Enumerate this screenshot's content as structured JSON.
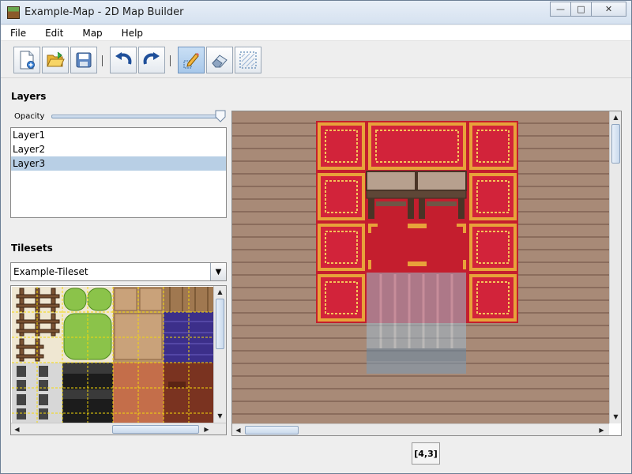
{
  "window": {
    "title": "Example-Map - 2D Map Builder"
  },
  "menu": [
    "File",
    "Edit",
    "Map",
    "Help"
  ],
  "toolbar": {
    "buttons": [
      {
        "name": "new-map-button",
        "icon": "new-document-icon"
      },
      {
        "name": "open-button",
        "icon": "open-folder-icon"
      },
      {
        "name": "save-button",
        "icon": "floppy-disk-icon"
      },
      {
        "name": "undo-button",
        "icon": "undo-arrow-icon"
      },
      {
        "name": "redo-button",
        "icon": "redo-arrow-icon"
      },
      {
        "name": "pencil-tool-button",
        "icon": "pencil-icon",
        "active": true
      },
      {
        "name": "eraser-tool-button",
        "icon": "eraser-icon"
      },
      {
        "name": "selection-tool-button",
        "icon": "selection-icon"
      }
    ]
  },
  "layers": {
    "title": "Layers",
    "opacity_label": "Opacity",
    "opacity_value": 1.0,
    "items": [
      "Layer1",
      "Layer2",
      "Layer3"
    ],
    "selected_index": 2
  },
  "tilesets": {
    "title": "Tilesets",
    "selected": "Example-Tileset"
  },
  "status": {
    "coords": "[4,3]"
  },
  "colors": {
    "carpet_red": "#c41e2e",
    "carpet_gold": "#e8a23a",
    "floor_wood": "#a88a77",
    "selection_blue": "#b8cfe5"
  }
}
